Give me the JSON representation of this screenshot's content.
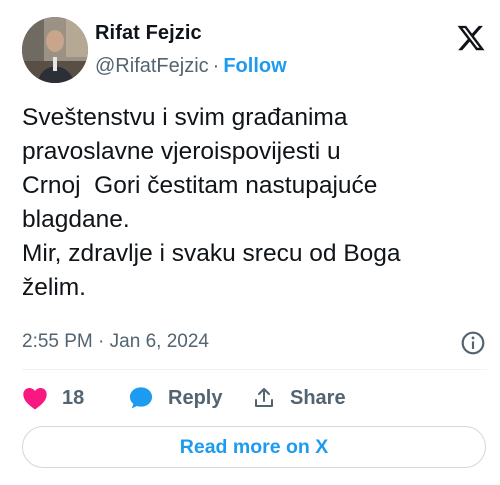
{
  "author": {
    "name": "Rifat Fejzic",
    "handle": "@RifatFejzic",
    "separator": "·",
    "follow_label": "Follow"
  },
  "tweet": {
    "lines": [
      "Sveštenstvu i svim građanima",
      "pravoslavne vjeroispovijesti u",
      "Crnoj  Gori čestitam nastupajuće",
      "blagdane.",
      "Mir, zdravlje i svaku srecu od Boga",
      "želim."
    ]
  },
  "meta": {
    "time": "2:55 PM",
    "separator": "·",
    "date": "Jan 6, 2024"
  },
  "actions": {
    "like_count": "18",
    "reply_label": "Reply",
    "share_label": "Share"
  },
  "read_more_label": "Read more on X",
  "icons": {
    "brand": "x-logo-icon",
    "info": "info-icon",
    "like": "heart-icon",
    "reply": "speech-bubble-icon",
    "share": "share-upload-icon"
  },
  "colors": {
    "accent": "#1d9bf0",
    "like": "#f91880",
    "text": "#0f1419",
    "secondary": "#536471"
  }
}
